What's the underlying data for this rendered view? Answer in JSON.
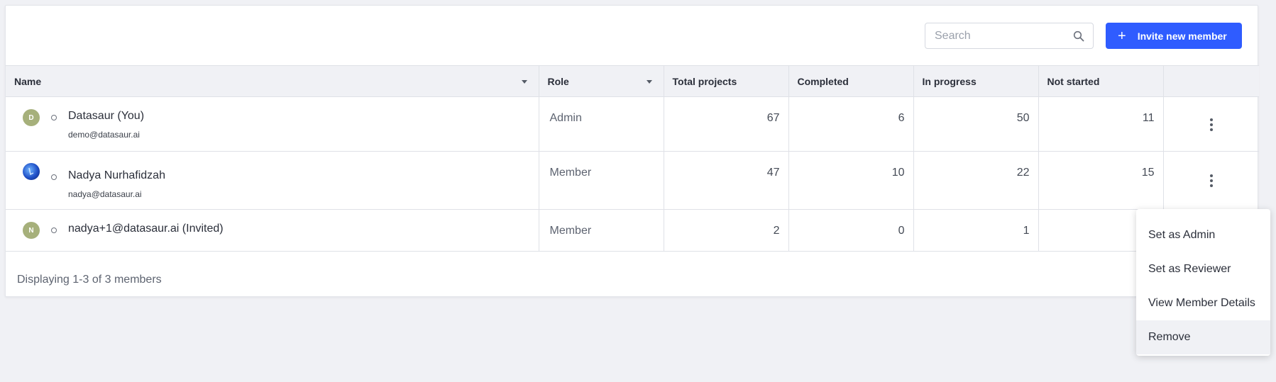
{
  "toolbar": {
    "search_placeholder": "Search",
    "invite_label": "Invite new member",
    "invite_icon": "plus-icon",
    "search_icon": "search-icon"
  },
  "table": {
    "columns": [
      "Name",
      "Role",
      "Total projects",
      "Completed",
      "In progress",
      "Not started"
    ],
    "rows": [
      {
        "avatar_initial": "D",
        "avatar_color": "#a6b07b",
        "name": "Datasaur  (You)",
        "email": "demo@datasaur.ai",
        "role": "Admin",
        "total": "67",
        "completed": "6",
        "in_progress": "50",
        "not_started": "11"
      },
      {
        "avatar_initial": "",
        "avatar_color": "#1f4fc7",
        "name": "Nadya Nurhafidzah",
        "email": "nadya@datasaur.ai",
        "role": "Member",
        "total": "47",
        "completed": "10",
        "in_progress": "22",
        "not_started": "15"
      },
      {
        "avatar_initial": "N",
        "avatar_color": "#a6b07b",
        "name": "nadya+1@datasaur.ai  (Invited)",
        "email": "",
        "role": "Member",
        "total": "2",
        "completed": "0",
        "in_progress": "1",
        "not_started": ""
      }
    ]
  },
  "footer": {
    "text": "Displaying 1-3 of 3 members"
  },
  "context_menu": {
    "items": [
      "Set as Admin",
      "Set as Reviewer",
      "View Member Details",
      "Remove"
    ]
  },
  "colors": {
    "accent": "#2f5cff",
    "background": "#f0f1f5"
  }
}
